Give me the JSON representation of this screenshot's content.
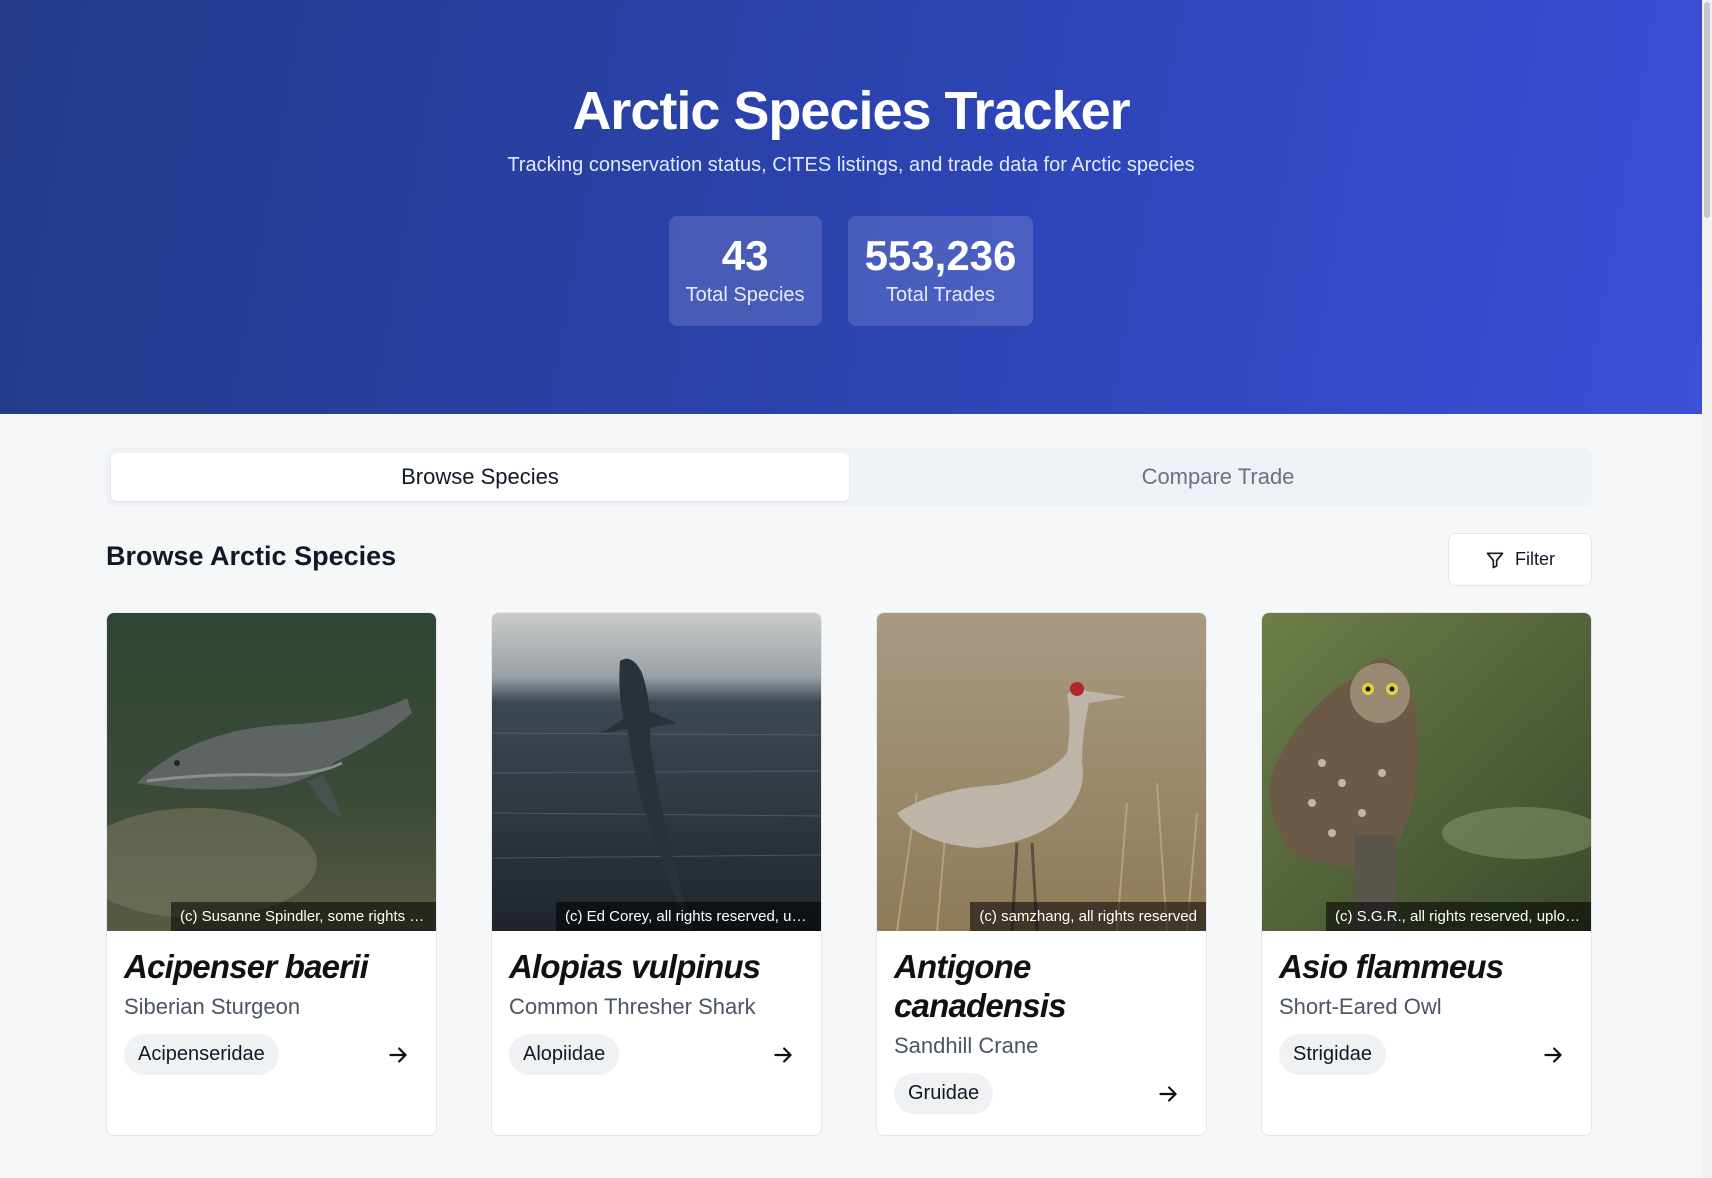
{
  "header": {
    "title": "Arctic Species Tracker",
    "subtitle": "Tracking conservation status, CITES listings, and trade data for Arctic species",
    "stats": [
      {
        "value": "43",
        "label": "Total Species"
      },
      {
        "value": "553,236",
        "label": "Total Trades"
      }
    ]
  },
  "tabs": [
    {
      "label": "Browse Species",
      "active": true
    },
    {
      "label": "Compare Trade",
      "active": false
    }
  ],
  "section": {
    "title": "Browse Arctic Species",
    "filter_label": "Filter"
  },
  "species": [
    {
      "scientific_name": "Acipenser baerii",
      "common_name": "Siberian Sturgeon",
      "family": "Acipenseridae",
      "photo_credit": "(c) Susanne Spindler, some rights reserved",
      "image_icon": "sturgeon-photo"
    },
    {
      "scientific_name": "Alopias vulpinus",
      "common_name": "Common Thresher Shark",
      "family": "Alopiidae",
      "photo_credit": "(c) Ed Corey, all rights reserved, uploaded",
      "image_icon": "shark-photo"
    },
    {
      "scientific_name": "Antigone canadensis",
      "common_name": "Sandhill Crane",
      "family": "Gruidae",
      "photo_credit": "(c) samzhang, all rights reserved",
      "image_icon": "crane-photo"
    },
    {
      "scientific_name": "Asio flammeus",
      "common_name": "Short-Eared Owl",
      "family": "Strigidae",
      "photo_credit": "(c) S.G.R., all rights reserved, uploaded",
      "image_icon": "owl-photo"
    }
  ],
  "colors": {
    "hero_start": "#243a88",
    "hero_end": "#3b4fd8"
  }
}
